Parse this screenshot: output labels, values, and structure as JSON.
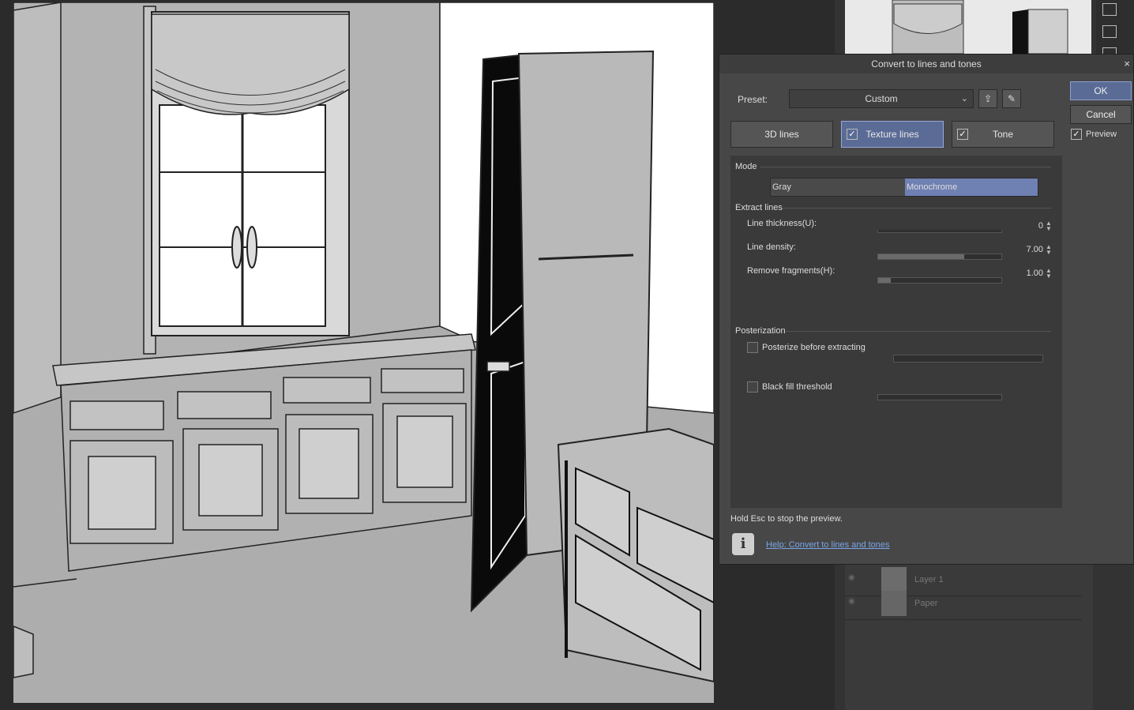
{
  "dialog": {
    "title": "Convert to lines and tones",
    "close": "×",
    "preset_label": "Preset:",
    "preset_value": "Custom",
    "ok": "OK",
    "cancel": "Cancel",
    "preview_label": "Preview",
    "preview_checked": true,
    "tabs": [
      {
        "label": "3D lines",
        "checked": null,
        "active": false
      },
      {
        "label": "Texture lines",
        "checked": true,
        "active": true
      },
      {
        "label": "Tone",
        "checked": true,
        "active": false
      }
    ],
    "mode": {
      "title": "Mode",
      "options": [
        "Gray",
        "Monochrome"
      ],
      "selected": "Monochrome"
    },
    "extract_lines": {
      "title": "Extract lines",
      "params": [
        {
          "label": "Line thickness(U):",
          "value": "0",
          "fill": 0.0
        },
        {
          "label": "Line density:",
          "value": "7.00",
          "fill": 0.7
        },
        {
          "label": "Remove fragments(H):",
          "value": "1.00",
          "fill": 0.1
        }
      ]
    },
    "posterization": {
      "title": "Posterization",
      "posterize_label": "Posterize before extracting",
      "black_fill_label": "Black fill threshold"
    },
    "hint": "Hold Esc to stop the preview.",
    "help_link": "Help: Convert to lines and tones"
  },
  "layers": [
    {
      "name": "Layer 1"
    },
    {
      "name": "Paper"
    }
  ],
  "icons": [
    "save-preset-icon",
    "settings-icon",
    "info-icon",
    "chevron-down-icon",
    "checkmark-icon",
    "eye-icon"
  ],
  "colors": {
    "accent": "#5a6b96",
    "link": "#7aa6e8",
    "panel": "#474747"
  }
}
